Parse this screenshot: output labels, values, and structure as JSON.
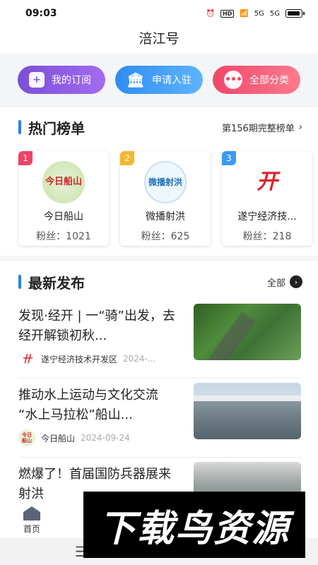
{
  "status": {
    "time": "09:03",
    "hd": "HD",
    "net1": "5G",
    "net2": "5G"
  },
  "title": "涪江号",
  "quick": [
    {
      "label": "我的订阅",
      "icon": "plus-note-icon"
    },
    {
      "label": "申请入驻",
      "icon": "building-icon"
    },
    {
      "label": "全部分类",
      "icon": "more-dots-icon"
    }
  ],
  "hot": {
    "title": "热门榜单",
    "more": "第156期完整榜单",
    "cards": [
      {
        "rank": "1",
        "name": "今日船山",
        "fans": "粉丝：1021",
        "logo_text": "今日船山"
      },
      {
        "rank": "2",
        "name": "微播射洪",
        "fans": "粉丝：625",
        "logo_text": "微播射洪"
      },
      {
        "rank": "3",
        "name": "遂宁经济技...",
        "fans": "粉丝：218",
        "logo_text": "开"
      }
    ]
  },
  "latest": {
    "title": "最新发布",
    "more": "全部",
    "items": [
      {
        "headline": "发现·经开 | 一“骑”出发，去经开解锁初秋...",
        "source": "遂宁经济技术开发区",
        "date": "2024-..."
      },
      {
        "headline": "推动水上运动与文化交流 “水上马拉松”船山...",
        "source": "今日船山",
        "date": "2024-09-24"
      },
      {
        "headline": "燃爆了！首届国防兵器展来射洪",
        "source": "",
        "date": ""
      }
    ]
  },
  "tabbar": {
    "home": "首页"
  },
  "navbar": {
    "menu": "☰"
  },
  "watermark": "下载鸟资源",
  "colors": {
    "accent": "#2d7ff0",
    "purple": "#8a5be6",
    "blue": "#3a95f2",
    "pink": "#f0476a"
  }
}
